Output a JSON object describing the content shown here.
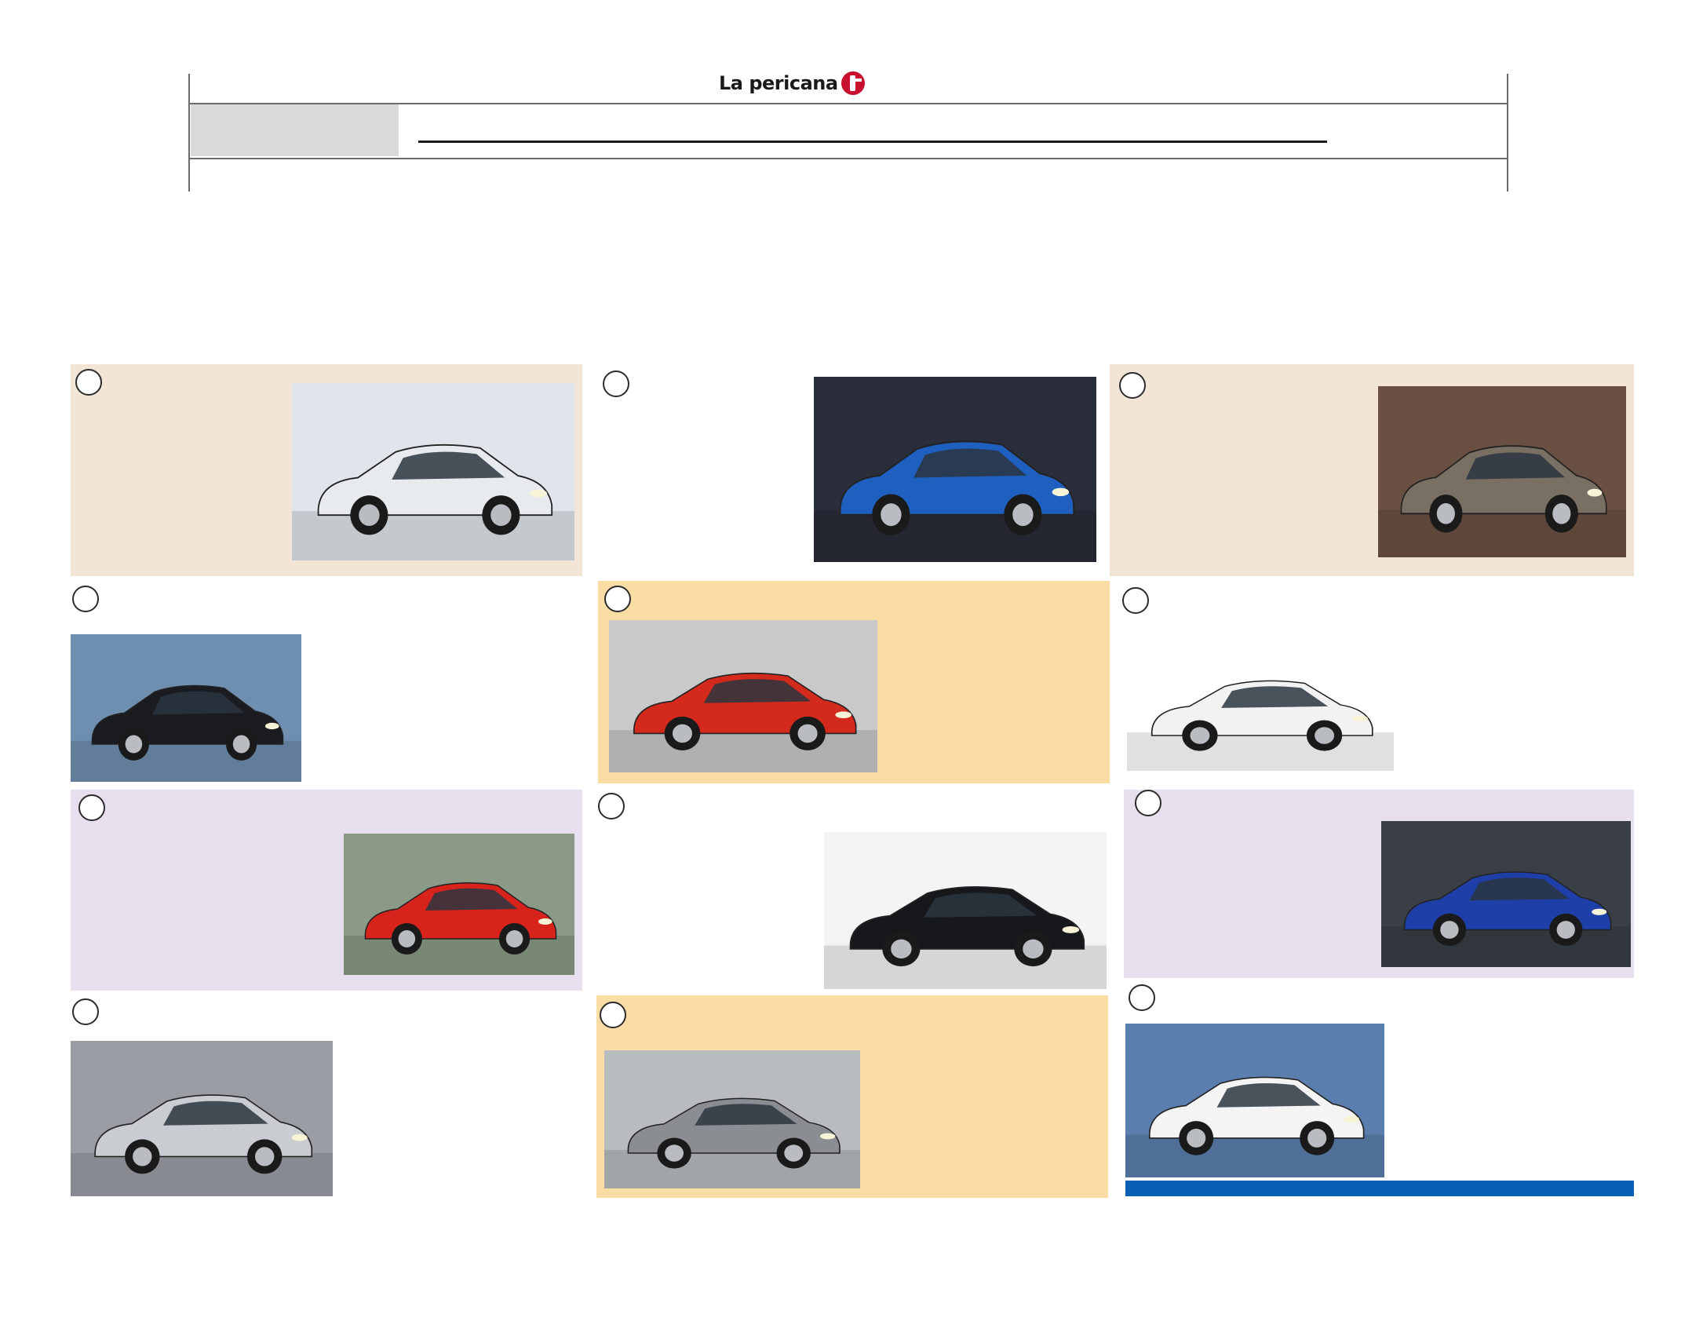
{
  "header": {
    "logo_text": "La pericana",
    "logo_mark": "pericana-logo-icon"
  },
  "colors": {
    "panel_beige": "#f3e5d6",
    "panel_yellow": "#fadca5",
    "panel_lilac": "#e8dfee",
    "accent_blue": "#0a5fb4"
  },
  "cars": [
    {
      "id": "audi-q7-white-suv",
      "color": "#e8ebee"
    },
    {
      "id": "bugatti-veyron-blue",
      "color": "#1f5fbf"
    },
    {
      "id": "porsche-concept-bronze",
      "color": "#7a6f63"
    },
    {
      "id": "ferrari-458-black",
      "color": "#1a1c22"
    },
    {
      "id": "ferrari-458-spider-red",
      "color": "#d42a1e"
    },
    {
      "id": "lamborghini-gallardo-white",
      "color": "#f2f2f2"
    },
    {
      "id": "ferrari-enzo-red",
      "color": "#d8231c"
    },
    {
      "id": "aston-martin-vanquish-black",
      "color": "#16181c"
    },
    {
      "id": "chevrolet-camaro-blue",
      "color": "#1e3fa8"
    },
    {
      "id": "audi-r8-silver",
      "color": "#c9ccd0"
    },
    {
      "id": "mercedes-sl-black-series",
      "color": "#8a8d91"
    },
    {
      "id": "nissan-gt-r-white",
      "color": "#f4f4f4"
    }
  ]
}
